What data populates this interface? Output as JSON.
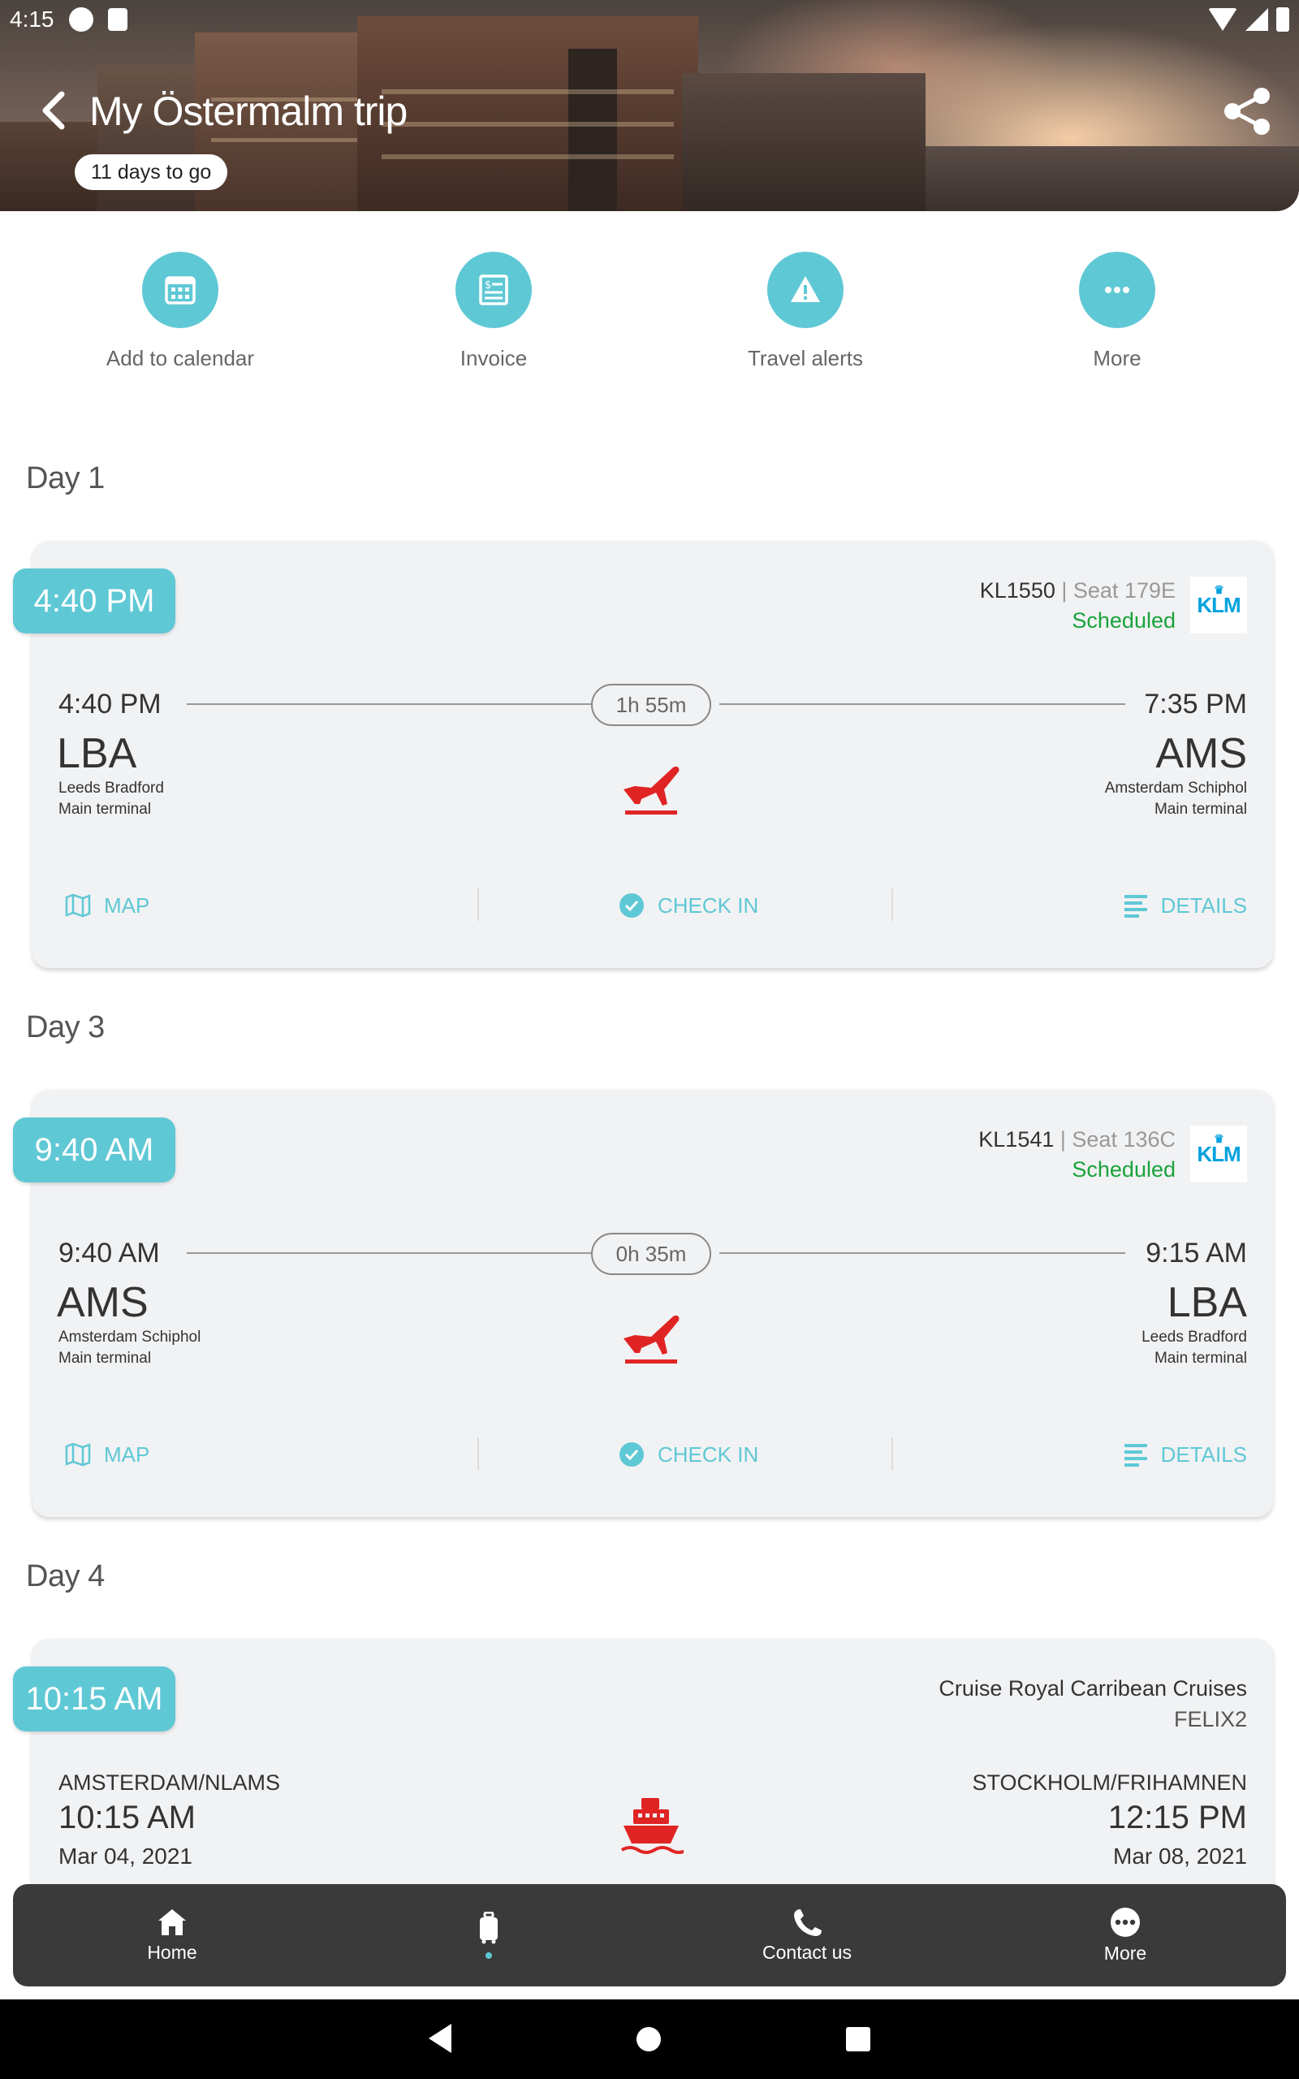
{
  "status_bar": {
    "time": "4:15"
  },
  "header": {
    "title": "My Östermalm trip",
    "countdown": "11 days to go"
  },
  "actions": [
    {
      "label": "Add to calendar",
      "icon": "calendar-icon"
    },
    {
      "label": "Invoice",
      "icon": "invoice-icon"
    },
    {
      "label": "Travel alerts",
      "icon": "warning-icon"
    },
    {
      "label": "More",
      "icon": "more-dots-icon"
    }
  ],
  "days": [
    {
      "title": "Day 1",
      "flight": {
        "time_pill": "4:40 PM",
        "flight_no": "KL1550",
        "seat": "| Seat 179E",
        "status": "Scheduled",
        "airline_logo": "KLM",
        "dep_time": "4:40 PM",
        "dep_code": "LBA",
        "dep_name": "Leeds Bradford",
        "dep_terminal": "Main terminal",
        "duration": "1h 55m",
        "arr_time": "7:35 PM",
        "arr_code": "AMS",
        "arr_name": "Amsterdam Schiphol",
        "arr_terminal": "Main terminal",
        "map_label": "MAP",
        "checkin_label": "CHECK IN",
        "details_label": "DETAILS"
      }
    },
    {
      "title": "Day 3",
      "flight": {
        "time_pill": "9:40 AM",
        "flight_no": "KL1541",
        "seat": "| Seat 136C",
        "status": "Scheduled",
        "airline_logo": "KLM",
        "dep_time": "9:40 AM",
        "dep_code": "AMS",
        "dep_name": "Amsterdam Schiphol",
        "dep_terminal": "Main terminal",
        "duration": "0h 35m",
        "arr_time": "9:15 AM",
        "arr_code": "LBA",
        "arr_name": "Leeds Bradford",
        "arr_terminal": "Main terminal",
        "map_label": "MAP",
        "checkin_label": "CHECK IN",
        "details_label": "DETAILS"
      }
    },
    {
      "title": "Day 4",
      "cruise": {
        "time_pill": "10:15 AM",
        "title": "Cruise Royal Carribean Cruises",
        "subtitle": "FELIX2",
        "dep_port": "AMSTERDAM/NLAMS",
        "dep_time": "10:15 AM",
        "dep_date": "Mar 04, 2021",
        "arr_port": "STOCKHOLM/FRIHAMNEN",
        "arr_time": "12:15 PM",
        "arr_date": "Mar 08, 2021"
      }
    }
  ],
  "bottom_nav": [
    {
      "label": "Home",
      "icon": "home-icon"
    },
    {
      "label": "",
      "icon": "luggage-icon",
      "active": true
    },
    {
      "label": "Contact us",
      "icon": "phone-icon"
    },
    {
      "label": "More",
      "icon": "more-dots-icon"
    }
  ],
  "colors": {
    "accent": "#5fc8d5",
    "status_ok": "#1aa33b",
    "transport_icon": "#e02424",
    "nav_bg": "#3a3a3a"
  }
}
